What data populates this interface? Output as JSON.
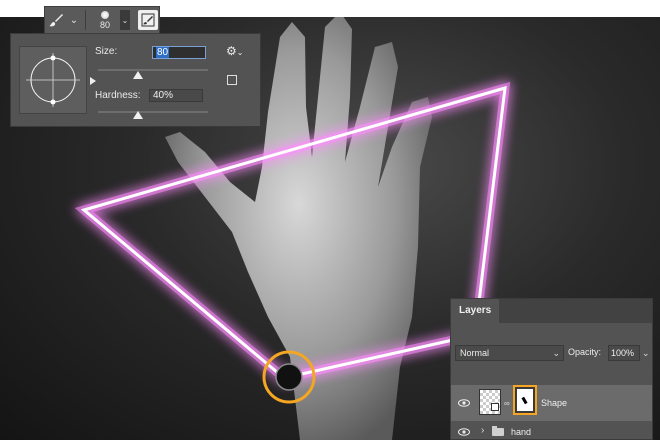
{
  "tool_options": {
    "brush_icon": "brush-icon",
    "brush_preset_size": "80",
    "settings_icon": "brush-settings-icon"
  },
  "brush_picker": {
    "size_label": "Size:",
    "size_value": "80",
    "hardness_label": "Hardness:",
    "hardness_value": "40%",
    "size_slider_fraction": 0.4,
    "hardness_slider_fraction": 0.4
  },
  "layers": {
    "tab_label": "Layers",
    "blend_mode": "Normal",
    "opacity_label": "Opacity:",
    "opacity_value": "100%",
    "items": [
      {
        "name": "Shape",
        "visible": true,
        "selected": true
      },
      {
        "name": "hand",
        "visible": true,
        "selected": false,
        "type": "group"
      }
    ]
  },
  "colors": {
    "neon": "#ff8cff",
    "highlight": "#f5a623",
    "panel": "#535353"
  }
}
